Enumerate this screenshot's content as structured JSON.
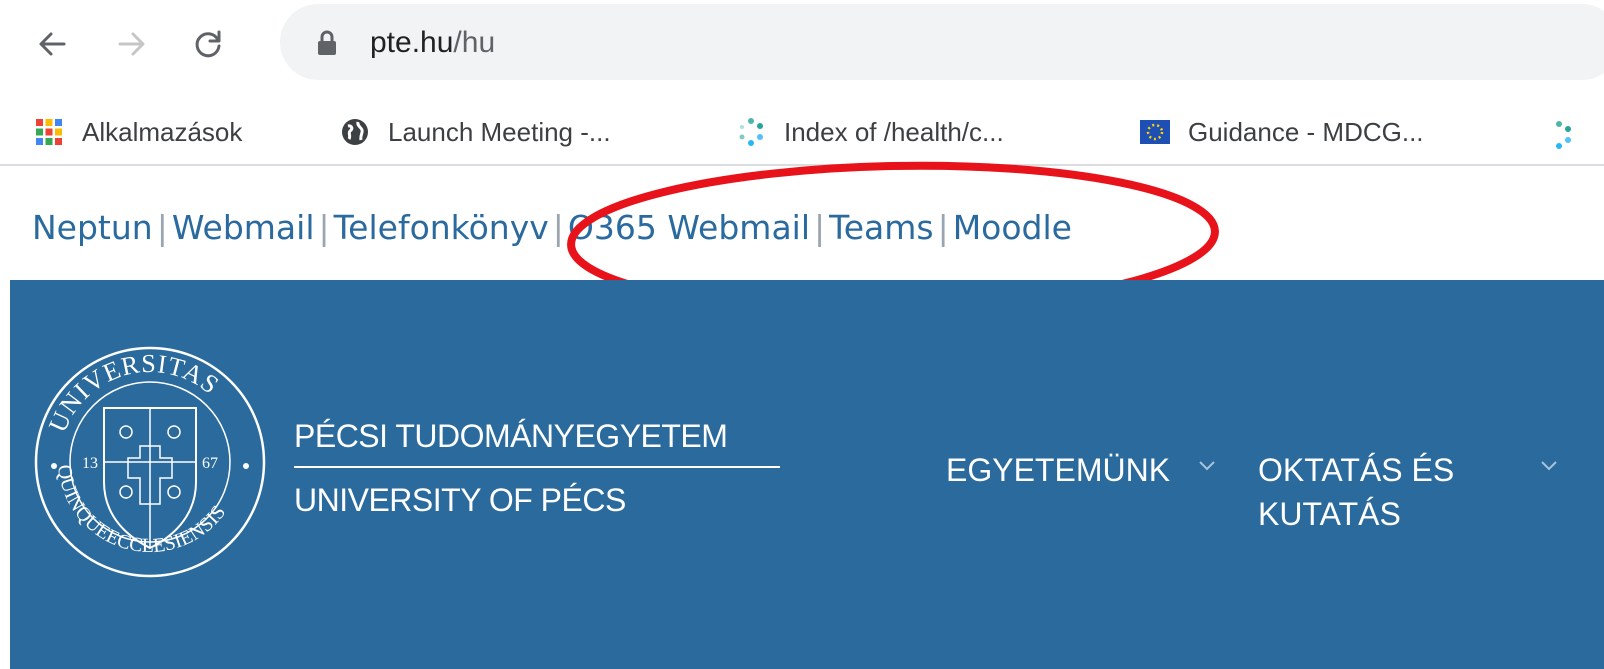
{
  "browser": {
    "url_domain": "pte.hu",
    "url_path": "/hu"
  },
  "bookmarks": [
    {
      "label": "Alkalmazások",
      "icon": "apps-grid-icon"
    },
    {
      "label": "Launch Meeting -...",
      "icon": "globe-icon"
    },
    {
      "label": "Index of /health/c...",
      "icon": "dots-loader-icon"
    },
    {
      "label": "Guidance - MDCG...",
      "icon": "eu-flag-icon"
    }
  ],
  "quicklinks": [
    "Neptun",
    "Webmail",
    "Telefonkönyv",
    "O365 Webmail",
    "Teams",
    "Moodle"
  ],
  "header": {
    "name_hu": "PÉCSI TUDOMÁNYEGYETEM",
    "name_en": "UNIVERSITY OF PÉCS",
    "seal_text": "UNIVERSITAS QUINQUEECCLESIENSIS 13 67"
  },
  "menu": {
    "item1": "EGYETEMÜNK",
    "item2_line1": "OKTATÁS ÉS",
    "item2_line2": "KUTATÁS"
  },
  "colors": {
    "brand_blue": "#2a6a9c",
    "link_blue": "#2a6a9e",
    "annotation_red": "#e8121a"
  }
}
